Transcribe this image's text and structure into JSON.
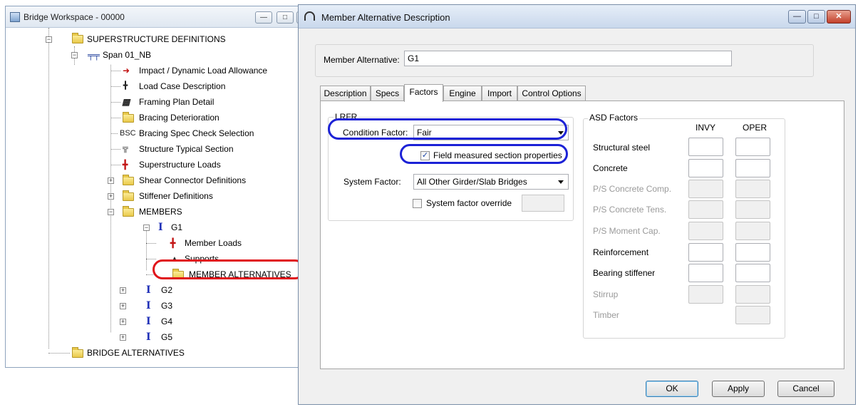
{
  "workspace": {
    "title": "Bridge Workspace - 00000",
    "tree": [
      {
        "label": "SUPERSTRUCTURE DEFINITIONS",
        "icon": "folder-icon"
      },
      {
        "label": "Span 01_NB",
        "icon": "span-icon"
      },
      {
        "label": "Impact / Dynamic Load Allowance",
        "icon": "impact-icon"
      },
      {
        "label": "Load Case Description",
        "icon": "load-case-icon"
      },
      {
        "label": "Framing Plan Detail",
        "icon": "framing-plan-icon"
      },
      {
        "label": "Bracing Deterioration",
        "icon": "folder-icon"
      },
      {
        "label": "Bracing Spec Check Selection",
        "icon": "bsc-icon"
      },
      {
        "label": "Structure Typical Section",
        "icon": "typical-section-icon"
      },
      {
        "label": "Superstructure Loads",
        "icon": "loads-icon"
      },
      {
        "label": "Shear Connector Definitions",
        "icon": "folder-icon"
      },
      {
        "label": "Stiffener Definitions",
        "icon": "folder-icon"
      },
      {
        "label": "MEMBERS",
        "icon": "folder-icon"
      },
      {
        "label": "G1",
        "icon": "girder-icon"
      },
      {
        "label": "Member Loads",
        "icon": "loads-icon"
      },
      {
        "label": "Supports",
        "icon": "supports-icon"
      },
      {
        "label": "MEMBER ALTERNATIVES",
        "icon": "folder-icon"
      },
      {
        "label": "G2",
        "icon": "girder-icon"
      },
      {
        "label": "G3",
        "icon": "girder-icon"
      },
      {
        "label": "G4",
        "icon": "girder-icon"
      },
      {
        "label": "G5",
        "icon": "girder-icon"
      },
      {
        "label": "BRIDGE ALTERNATIVES",
        "icon": "folder-icon"
      }
    ],
    "bsc_text": "BSC"
  },
  "dialog": {
    "title": "Member Alternative Description",
    "member_alternative_label": "Member Alternative:",
    "member_alternative_value": "G1",
    "tabs": [
      "Description",
      "Specs",
      "Factors",
      "Engine",
      "Import",
      "Control Options"
    ],
    "active_tab": "Factors",
    "lrfr": {
      "title": "LRFR",
      "condition_factor_label": "Condition Factor:",
      "condition_factor_value": "Fair",
      "field_measured_label": "Field measured section properties",
      "field_measured_checked": true,
      "system_factor_label": "System Factor:",
      "system_factor_value": "All Other Girder/Slab Bridges",
      "system_override_label": "System factor override",
      "system_override_checked": false
    },
    "asd": {
      "title": "ASD Factors",
      "col_invy": "INVY",
      "col_oper": "OPER",
      "rows": [
        {
          "label": "Structural steel",
          "enabled": true
        },
        {
          "label": "Concrete",
          "enabled": true
        },
        {
          "label": "P/S Concrete Comp.",
          "enabled": false
        },
        {
          "label": "P/S Concrete Tens.",
          "enabled": false
        },
        {
          "label": "P/S Moment Cap.",
          "enabled": false
        },
        {
          "label": "Reinforcement",
          "enabled": true
        },
        {
          "label": "Bearing stiffener",
          "enabled": true
        },
        {
          "label": "Stirrup",
          "enabled": false
        },
        {
          "label": "Timber",
          "enabled": false
        }
      ]
    },
    "buttons": {
      "ok": "OK",
      "apply": "Apply",
      "cancel": "Cancel"
    }
  },
  "colors": {
    "highlight_blue": "#1c22d6",
    "highlight_red": "#e0141a",
    "girder_blue": "#2232b8"
  }
}
